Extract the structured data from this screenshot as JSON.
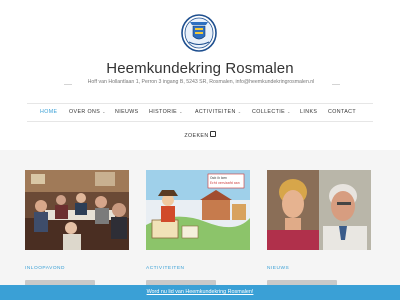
{
  "site": {
    "title": "Heemkundekring Rosmalen",
    "address": "Hoff van Hollantlaan 1, Perron 3 ingang B, 5243 SR, Rosmalen, info@heemkundekringrosmalen.nl"
  },
  "logo": {
    "icon": "club-crest-icon",
    "text_top": "Heemkundekring",
    "text_bottom": "Rosmalen"
  },
  "nav": {
    "items": [
      {
        "label": "HOME",
        "active": true,
        "dropdown": false
      },
      {
        "label": "OVER ONS",
        "active": false,
        "dropdown": true
      },
      {
        "label": "NIEUWS",
        "active": false,
        "dropdown": false
      },
      {
        "label": "HISTORIE",
        "active": false,
        "dropdown": true
      },
      {
        "label": "ACTIVITEITEN",
        "active": false,
        "dropdown": true
      },
      {
        "label": "COLLECTIE",
        "active": false,
        "dropdown": true
      },
      {
        "label": "LINKS",
        "active": false,
        "dropdown": false
      },
      {
        "label": "CONTACT",
        "active": false,
        "dropdown": false
      }
    ],
    "search_label": "ZOEKEN",
    "search_icon": "search-icon"
  },
  "cards": [
    {
      "category": "INLOOPAVOND"
    },
    {
      "category": "ACTIVITEITEN",
      "poster_line1": "Ook ik ben",
      "poster_line2": "Echt verslaafd aan"
    },
    {
      "category": "NIEUWS"
    }
  ],
  "footer": {
    "link_text": "Word nu lid van Heemkundekring Rosmalen!"
  },
  "colors": {
    "accent": "#3aa0d6",
    "background": "#f5f5f5"
  }
}
